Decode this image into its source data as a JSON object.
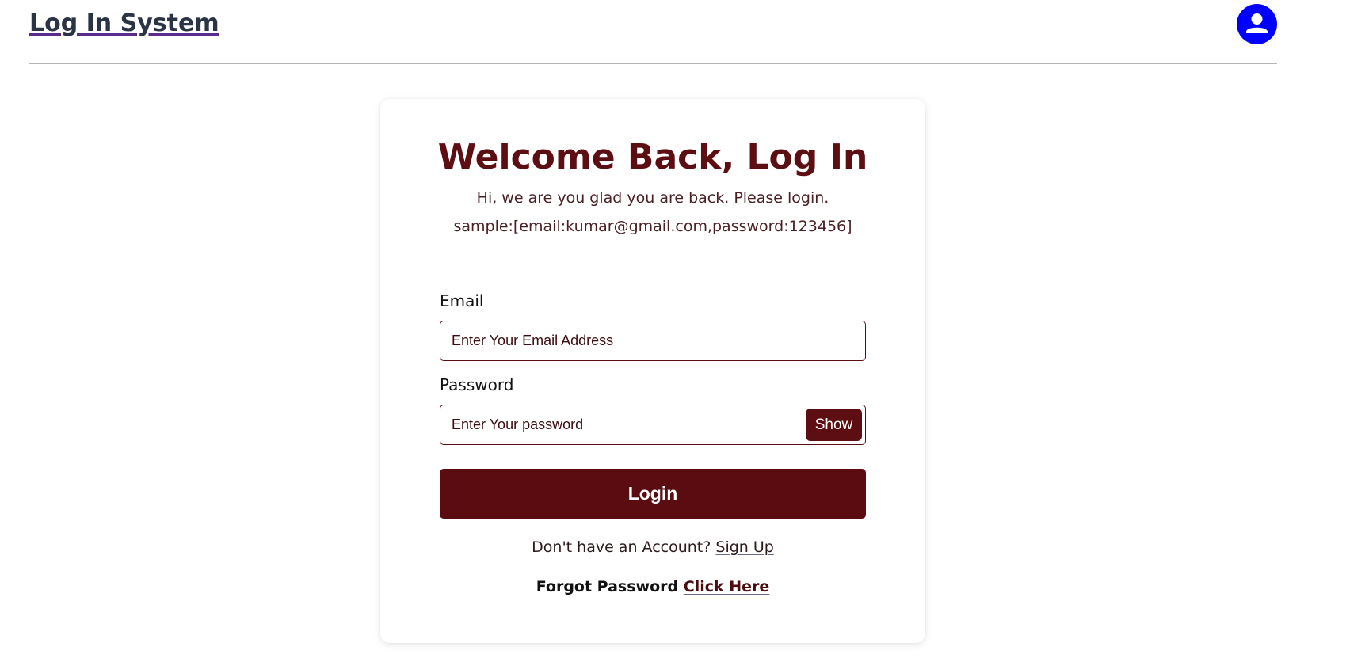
{
  "header": {
    "brand": "Log In System",
    "avatar_icon": "user-icon",
    "avatar_color": "#0000ff"
  },
  "card": {
    "title": "Welcome Back, Log In",
    "subtitle": "Hi, we are you glad you are back. Please login.",
    "sample": "sample:[email:kumar@gmail.com,password:123456]"
  },
  "form": {
    "email_label": "Email",
    "email_placeholder": "Enter Your Email Address",
    "email_value": "",
    "password_label": "Password",
    "password_placeholder": "Enter Your password",
    "password_value": "",
    "show_label": "Show",
    "login_label": "Login"
  },
  "footer": {
    "signup_prompt": "Don't have an Account?",
    "signup_link": "Sign Up",
    "forgot_prompt": "Forgot Password",
    "forgot_link": "Click Here"
  },
  "colors": {
    "accent": "#5c0e12",
    "brand_text": "#2b3445"
  }
}
